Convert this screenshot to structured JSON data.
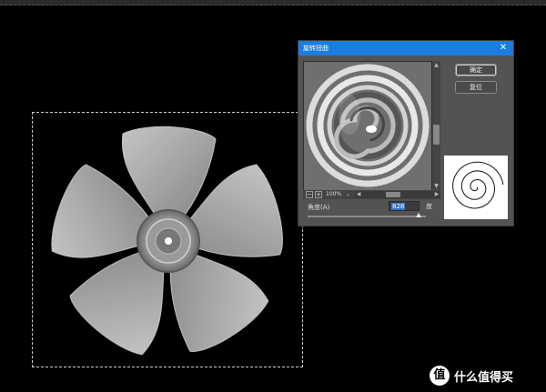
{
  "dialog": {
    "title": "旋转扭曲",
    "close_label": "✕",
    "ok_label": "确定",
    "reset_label": "复位",
    "zoom_level": "100%",
    "zoom_minus": "−",
    "zoom_plus": "+",
    "angle_label": "角度(A)",
    "angle_value": "828",
    "angle_unit": "度",
    "dropdown_glyph": "⌄"
  },
  "watermark": {
    "logo_text": "值",
    "text": "什么值得买"
  }
}
